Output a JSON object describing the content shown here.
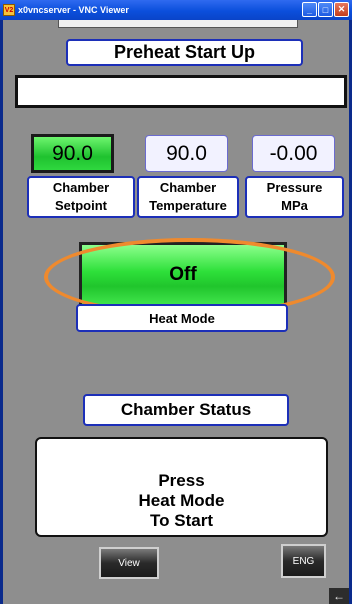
{
  "window": {
    "app_icon": "V2",
    "title": "x0vncserver - VNC Viewer",
    "minimize": "_",
    "maximize": "□",
    "close": "✕"
  },
  "screen": {
    "title": "Preheat Start Up",
    "message": "",
    "readouts": [
      {
        "value": "90.0",
        "label_line1": "Chamber",
        "label_line2": "Setpoint"
      },
      {
        "value": "90.0",
        "label_line1": "Chamber",
        "label_line2": "Temperature"
      },
      {
        "value": "-0.00",
        "label_line1": "Pressure",
        "label_line2": "MPa"
      }
    ],
    "heat_button_label": "Off",
    "heat_mode_label": "Heat Mode",
    "status_title": "Chamber Status",
    "status_lines": [
      "Press",
      "Heat Mode",
      "To Start"
    ],
    "view_button": "View",
    "eng_button": "ENG",
    "corner_icon": "←"
  },
  "colors": {
    "highlight_ring": "#ef8a2e",
    "active_green": "#2ee03a",
    "label_border": "#1c2fb8"
  }
}
